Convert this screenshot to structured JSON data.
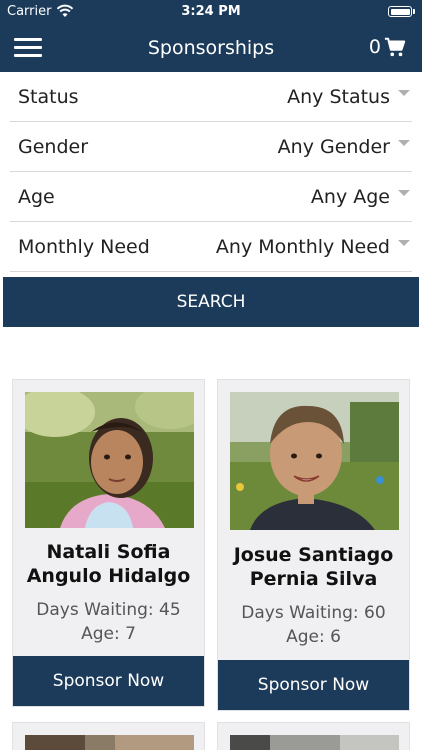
{
  "status_bar": {
    "carrier": "Carrier",
    "time": "3:24 PM"
  },
  "nav": {
    "title": "Sponsorships",
    "cart_count": "0",
    "menu_icon": "hamburger-icon",
    "cart_icon": "cart-icon"
  },
  "filters": [
    {
      "label": "Status",
      "value": "Any Status"
    },
    {
      "label": "Gender",
      "value": "Any Gender"
    },
    {
      "label": "Age",
      "value": "Any Age"
    },
    {
      "label": "Monthly Need",
      "value": "Any Monthly Need"
    }
  ],
  "search_label": "SEARCH",
  "children": [
    {
      "name_line1": "Natali Sofia",
      "name_line2": "Angulo Hidalgo",
      "days_waiting": "Days Waiting: 45",
      "age": "Age: 7",
      "button": "Sponsor Now"
    },
    {
      "name_line1": "Josue Santiago",
      "name_line2": "Pernia Silva",
      "days_waiting": "Days Waiting: 60",
      "age": "Age: 6",
      "button": "Sponsor Now"
    }
  ],
  "colors": {
    "primary": "#1c3a59",
    "card_bg": "#f0f0f2"
  }
}
